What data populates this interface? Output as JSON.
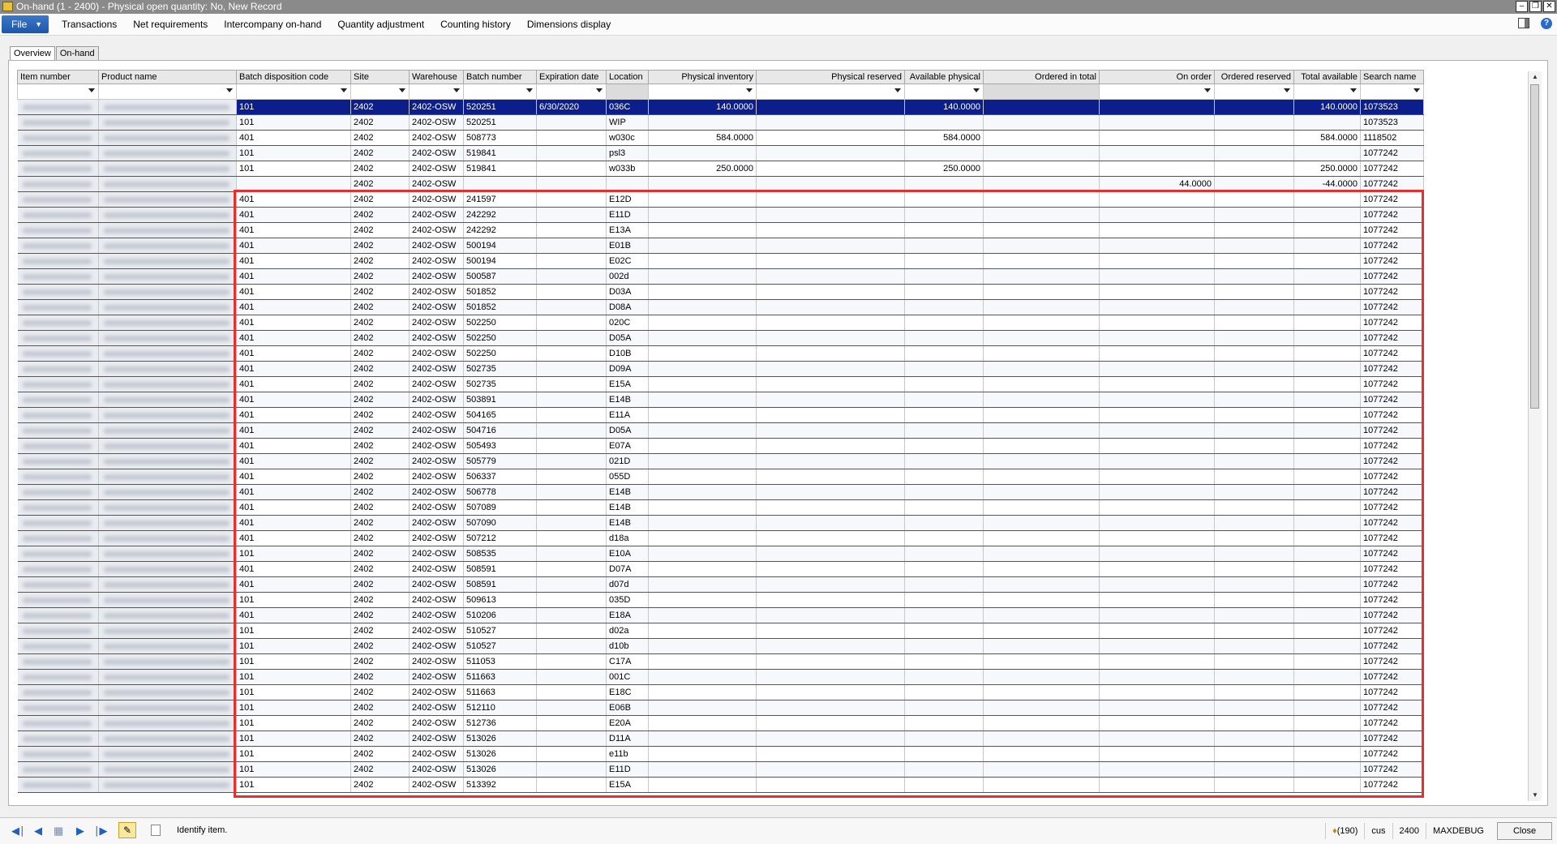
{
  "window": {
    "title": "On-hand (1 - 2400) - Physical open quantity: No, New Record"
  },
  "menu": {
    "file": "File",
    "items": [
      "Transactions",
      "Net requirements",
      "Intercompany on-hand",
      "Quantity adjustment",
      "Counting history",
      "Dimensions display"
    ]
  },
  "tabs": [
    {
      "label": "Overview",
      "active": true
    },
    {
      "label": "On-hand",
      "active": false
    }
  ],
  "columns": [
    "Item number",
    "Product name",
    "Batch disposition code",
    "Site",
    "Warehouse",
    "Batch number",
    "Expiration date",
    "Location",
    "Physical inventory",
    "Physical reserved",
    "Available physical",
    "Ordered in total",
    "On order",
    "Ordered reserved",
    "Total available",
    "Search name"
  ],
  "rows": [
    [
      "",
      "",
      "101",
      "2402",
      "2402-OSW",
      "520251",
      "6/30/2020",
      "036C",
      "140.0000",
      "",
      "140.0000",
      "",
      "",
      "",
      "140.0000",
      "1073523"
    ],
    [
      "",
      "",
      "101",
      "2402",
      "2402-OSW",
      "520251",
      "",
      "WIP",
      "",
      "",
      "",
      "",
      "",
      "",
      "",
      "1073523"
    ],
    [
      "",
      "",
      "401",
      "2402",
      "2402-OSW",
      "508773",
      "",
      "w030c",
      "584.0000",
      "",
      "584.0000",
      "",
      "",
      "",
      "584.0000",
      "1118502"
    ],
    [
      "",
      "",
      "101",
      "2402",
      "2402-OSW",
      "519841",
      "",
      "psl3",
      "",
      "",
      "",
      "",
      "",
      "",
      "",
      "1077242"
    ],
    [
      "",
      "",
      "101",
      "2402",
      "2402-OSW",
      "519841",
      "",
      "w033b",
      "250.0000",
      "",
      "250.0000",
      "",
      "",
      "",
      "250.0000",
      "1077242"
    ],
    [
      "",
      "",
      "",
      "2402",
      "2402-OSW",
      "",
      "",
      "",
      "",
      "",
      "",
      "",
      "44.0000",
      "",
      "-44.0000",
      "1077242"
    ],
    [
      "",
      "",
      "401",
      "2402",
      "2402-OSW",
      "241597",
      "",
      "E12D",
      "",
      "",
      "",
      "",
      "",
      "",
      "",
      "1077242"
    ],
    [
      "",
      "",
      "401",
      "2402",
      "2402-OSW",
      "242292",
      "",
      "E11D",
      "",
      "",
      "",
      "",
      "",
      "",
      "",
      "1077242"
    ],
    [
      "",
      "",
      "401",
      "2402",
      "2402-OSW",
      "242292",
      "",
      "E13A",
      "",
      "",
      "",
      "",
      "",
      "",
      "",
      "1077242"
    ],
    [
      "",
      "",
      "401",
      "2402",
      "2402-OSW",
      "500194",
      "",
      "E01B",
      "",
      "",
      "",
      "",
      "",
      "",
      "",
      "1077242"
    ],
    [
      "",
      "",
      "401",
      "2402",
      "2402-OSW",
      "500194",
      "",
      "E02C",
      "",
      "",
      "",
      "",
      "",
      "",
      "",
      "1077242"
    ],
    [
      "",
      "",
      "401",
      "2402",
      "2402-OSW",
      "500587",
      "",
      "002d",
      "",
      "",
      "",
      "",
      "",
      "",
      "",
      "1077242"
    ],
    [
      "",
      "",
      "401",
      "2402",
      "2402-OSW",
      "501852",
      "",
      "D03A",
      "",
      "",
      "",
      "",
      "",
      "",
      "",
      "1077242"
    ],
    [
      "",
      "",
      "401",
      "2402",
      "2402-OSW",
      "501852",
      "",
      "D08A",
      "",
      "",
      "",
      "",
      "",
      "",
      "",
      "1077242"
    ],
    [
      "",
      "",
      "401",
      "2402",
      "2402-OSW",
      "502250",
      "",
      "020C",
      "",
      "",
      "",
      "",
      "",
      "",
      "",
      "1077242"
    ],
    [
      "",
      "",
      "401",
      "2402",
      "2402-OSW",
      "502250",
      "",
      "D05A",
      "",
      "",
      "",
      "",
      "",
      "",
      "",
      "1077242"
    ],
    [
      "",
      "",
      "401",
      "2402",
      "2402-OSW",
      "502250",
      "",
      "D10B",
      "",
      "",
      "",
      "",
      "",
      "",
      "",
      "1077242"
    ],
    [
      "",
      "",
      "401",
      "2402",
      "2402-OSW",
      "502735",
      "",
      "D09A",
      "",
      "",
      "",
      "",
      "",
      "",
      "",
      "1077242"
    ],
    [
      "",
      "",
      "401",
      "2402",
      "2402-OSW",
      "502735",
      "",
      "E15A",
      "",
      "",
      "",
      "",
      "",
      "",
      "",
      "1077242"
    ],
    [
      "",
      "",
      "401",
      "2402",
      "2402-OSW",
      "503891",
      "",
      "E14B",
      "",
      "",
      "",
      "",
      "",
      "",
      "",
      "1077242"
    ],
    [
      "",
      "",
      "401",
      "2402",
      "2402-OSW",
      "504165",
      "",
      "E11A",
      "",
      "",
      "",
      "",
      "",
      "",
      "",
      "1077242"
    ],
    [
      "",
      "",
      "401",
      "2402",
      "2402-OSW",
      "504716",
      "",
      "D05A",
      "",
      "",
      "",
      "",
      "",
      "",
      "",
      "1077242"
    ],
    [
      "",
      "",
      "401",
      "2402",
      "2402-OSW",
      "505493",
      "",
      "E07A",
      "",
      "",
      "",
      "",
      "",
      "",
      "",
      "1077242"
    ],
    [
      "",
      "",
      "401",
      "2402",
      "2402-OSW",
      "505779",
      "",
      "021D",
      "",
      "",
      "",
      "",
      "",
      "",
      "",
      "1077242"
    ],
    [
      "",
      "",
      "401",
      "2402",
      "2402-OSW",
      "506337",
      "",
      "055D",
      "",
      "",
      "",
      "",
      "",
      "",
      "",
      "1077242"
    ],
    [
      "",
      "",
      "401",
      "2402",
      "2402-OSW",
      "506778",
      "",
      "E14B",
      "",
      "",
      "",
      "",
      "",
      "",
      "",
      "1077242"
    ],
    [
      "",
      "",
      "401",
      "2402",
      "2402-OSW",
      "507089",
      "",
      "E14B",
      "",
      "",
      "",
      "",
      "",
      "",
      "",
      "1077242"
    ],
    [
      "",
      "",
      "401",
      "2402",
      "2402-OSW",
      "507090",
      "",
      "E14B",
      "",
      "",
      "",
      "",
      "",
      "",
      "",
      "1077242"
    ],
    [
      "",
      "",
      "401",
      "2402",
      "2402-OSW",
      "507212",
      "",
      "d18a",
      "",
      "",
      "",
      "",
      "",
      "",
      "",
      "1077242"
    ],
    [
      "",
      "",
      "101",
      "2402",
      "2402-OSW",
      "508535",
      "",
      "E10A",
      "",
      "",
      "",
      "",
      "",
      "",
      "",
      "1077242"
    ],
    [
      "",
      "",
      "401",
      "2402",
      "2402-OSW",
      "508591",
      "",
      "D07A",
      "",
      "",
      "",
      "",
      "",
      "",
      "",
      "1077242"
    ],
    [
      "",
      "",
      "401",
      "2402",
      "2402-OSW",
      "508591",
      "",
      "d07d",
      "",
      "",
      "",
      "",
      "",
      "",
      "",
      "1077242"
    ],
    [
      "",
      "",
      "101",
      "2402",
      "2402-OSW",
      "509613",
      "",
      "035D",
      "",
      "",
      "",
      "",
      "",
      "",
      "",
      "1077242"
    ],
    [
      "",
      "",
      "401",
      "2402",
      "2402-OSW",
      "510206",
      "",
      "E18A",
      "",
      "",
      "",
      "",
      "",
      "",
      "",
      "1077242"
    ],
    [
      "",
      "",
      "101",
      "2402",
      "2402-OSW",
      "510527",
      "",
      "d02a",
      "",
      "",
      "",
      "",
      "",
      "",
      "",
      "1077242"
    ],
    [
      "",
      "",
      "101",
      "2402",
      "2402-OSW",
      "510527",
      "",
      "d10b",
      "",
      "",
      "",
      "",
      "",
      "",
      "",
      "1077242"
    ],
    [
      "",
      "",
      "101",
      "2402",
      "2402-OSW",
      "511053",
      "",
      "C17A",
      "",
      "",
      "",
      "",
      "",
      "",
      "",
      "1077242"
    ],
    [
      "",
      "",
      "101",
      "2402",
      "2402-OSW",
      "511663",
      "",
      "001C",
      "",
      "",
      "",
      "",
      "",
      "",
      "",
      "1077242"
    ],
    [
      "",
      "",
      "101",
      "2402",
      "2402-OSW",
      "511663",
      "",
      "E18C",
      "",
      "",
      "",
      "",
      "",
      "",
      "",
      "1077242"
    ],
    [
      "",
      "",
      "101",
      "2402",
      "2402-OSW",
      "512110",
      "",
      "E06B",
      "",
      "",
      "",
      "",
      "",
      "",
      "",
      "1077242"
    ],
    [
      "",
      "",
      "101",
      "2402",
      "2402-OSW",
      "512736",
      "",
      "E20A",
      "",
      "",
      "",
      "",
      "",
      "",
      "",
      "1077242"
    ],
    [
      "",
      "",
      "101",
      "2402",
      "2402-OSW",
      "513026",
      "",
      "D11A",
      "",
      "",
      "",
      "",
      "",
      "",
      "",
      "1077242"
    ],
    [
      "",
      "",
      "101",
      "2402",
      "2402-OSW",
      "513026",
      "",
      "e11b",
      "",
      "",
      "",
      "",
      "",
      "",
      "",
      "1077242"
    ],
    [
      "",
      "",
      "101",
      "2402",
      "2402-OSW",
      "513026",
      "",
      "E11D",
      "",
      "",
      "",
      "",
      "",
      "",
      "",
      "1077242"
    ],
    [
      "",
      "",
      "101",
      "2402",
      "2402-OSW",
      "513392",
      "",
      "E15A",
      "",
      "",
      "",
      "",
      "",
      "",
      "",
      "1077242"
    ]
  ],
  "status": {
    "text": "Identify item.",
    "notifications": "(190)",
    "company": "cus",
    "site": "2400",
    "user": "MAXDEBUG",
    "close": "Close"
  },
  "icons": {
    "nav": [
      "first-record-icon",
      "previous-record-icon",
      "grid-view-icon",
      "next-record-icon",
      "last-record-icon"
    ],
    "edit": "pencil-icon",
    "attach": "document-icon",
    "bell": "bell-icon"
  },
  "colors": {
    "selected_row": "#0c1e8c",
    "highlight_box": "#e53030",
    "file_button": "#2a62b8"
  }
}
